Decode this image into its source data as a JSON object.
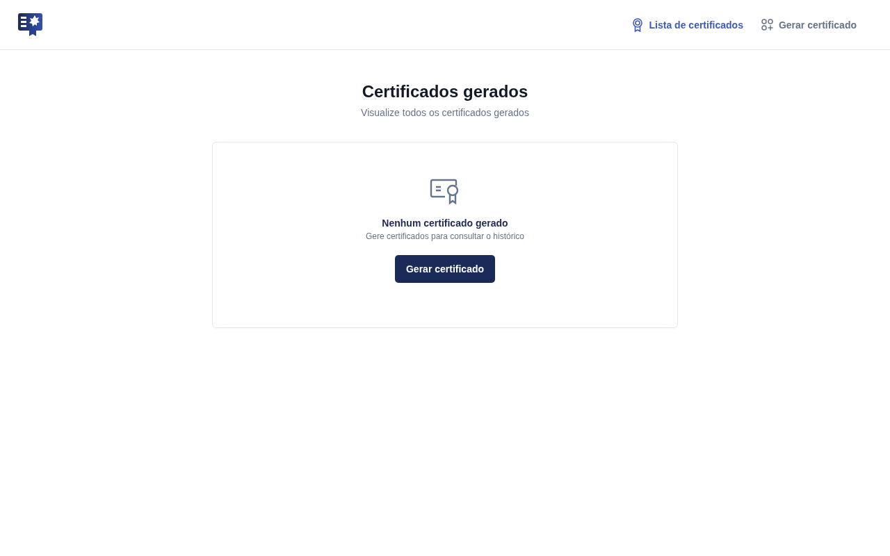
{
  "nav": [
    {
      "label": "Lista de certificados",
      "selected": true,
      "kind": "award"
    },
    {
      "label": "Gerar certificado",
      "selected": false,
      "kind": "shapes"
    }
  ],
  "header": {
    "title": "Certificados gerados",
    "subtitle": "Visualize todos os certificados gerados"
  },
  "empty_state": {
    "title": "Nenhum certificado gerado",
    "message": "Gere certificados para consultar o histórico",
    "button": "Gerar certificado"
  }
}
